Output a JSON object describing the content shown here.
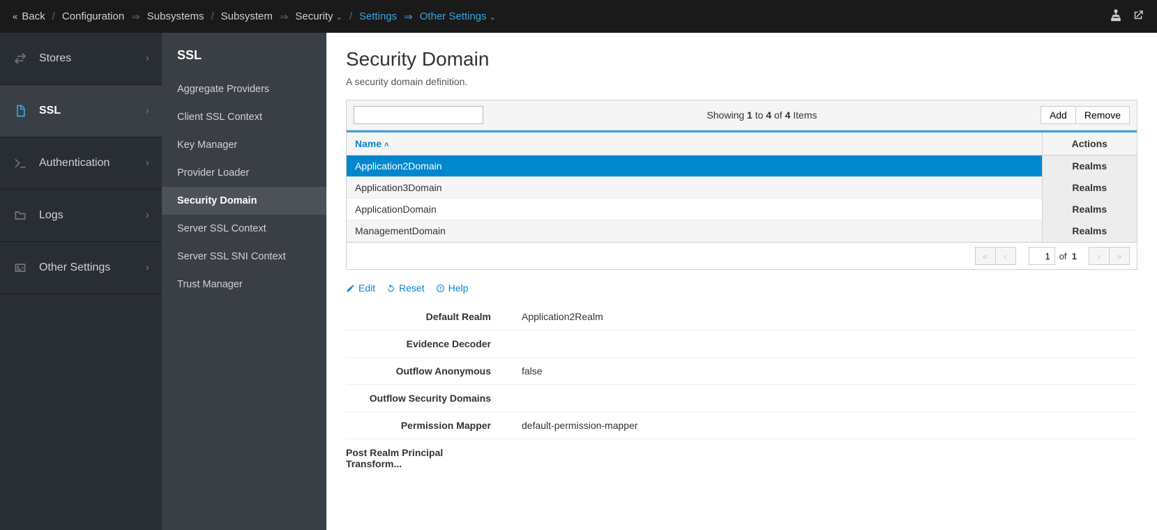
{
  "breadcrumb": {
    "back": "Back",
    "items": [
      {
        "a": "Configuration",
        "b": "Subsystems"
      },
      {
        "a": "Subsystem",
        "b": "Security",
        "dropdown": true
      },
      {
        "a": "Settings",
        "b": "Other Settings",
        "link": true,
        "dropdown": true
      }
    ]
  },
  "sidebar1": {
    "items": [
      {
        "label": "Stores",
        "icon": "transfer"
      },
      {
        "label": "SSL",
        "icon": "file",
        "active": true
      },
      {
        "label": "Authentication",
        "icon": "terminal"
      },
      {
        "label": "Logs",
        "icon": "folder"
      },
      {
        "label": "Other Settings",
        "icon": "idcard"
      }
    ]
  },
  "sidebar2": {
    "title": "SSL",
    "items": [
      "Aggregate Providers",
      "Client SSL Context",
      "Key Manager",
      "Provider Loader",
      "Security Domain",
      "Server SSL Context",
      "Server SSL SNI Context",
      "Trust Manager"
    ],
    "active_index": 4
  },
  "main": {
    "title": "Security Domain",
    "subtitle": "A security domain definition.",
    "toolbar": {
      "status_prefix": "Showing ",
      "from": "1",
      "to_word": " to ",
      "to": "4",
      "of_word": " of ",
      "total": "4",
      "items_word": " Items",
      "add": "Add",
      "remove": "Remove"
    },
    "columns": {
      "name": "Name",
      "actions": "Actions"
    },
    "rows": [
      {
        "name": "Application2Domain",
        "action": "Realms",
        "selected": true
      },
      {
        "name": "Application3Domain",
        "action": "Realms"
      },
      {
        "name": "ApplicationDomain",
        "action": "Realms"
      },
      {
        "name": "ManagementDomain",
        "action": "Realms"
      }
    ],
    "pagination": {
      "page": "1",
      "of": "of",
      "total": "1"
    },
    "actions": {
      "edit": "Edit",
      "reset": "Reset",
      "help": "Help"
    },
    "details": [
      {
        "label": "Default Realm",
        "value": "Application2Realm"
      },
      {
        "label": "Evidence Decoder",
        "value": ""
      },
      {
        "label": "Outflow Anonymous",
        "value": "false"
      },
      {
        "label": "Outflow Security Domains",
        "value": ""
      },
      {
        "label": "Permission Mapper",
        "value": "default-permission-mapper"
      },
      {
        "label": "Post Realm Principal Transform...",
        "value": ""
      }
    ]
  }
}
